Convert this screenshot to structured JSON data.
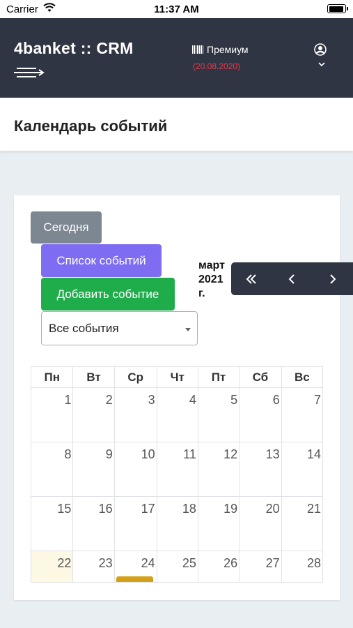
{
  "status_bar": {
    "carrier": "Carrier",
    "time": "11:37 AM"
  },
  "topbar": {
    "brand": "4banket :: CRM",
    "plan_label": "Премиум",
    "plan_date": "(20.08.2020)",
    "plan_date_color": "#e8384f",
    "icons": [
      "menu-icon",
      "barcode-icon",
      "user-circle-icon",
      "chevron-down-icon"
    ]
  },
  "page": {
    "title": "Календарь событий"
  },
  "buttons": {
    "today": "Сегодня",
    "list": "Список событий",
    "add": "Добавить событие"
  },
  "filter": {
    "selected": "Все события"
  },
  "month_title": {
    "month": "март",
    "year": "2021",
    "suffix": "г."
  },
  "nav": {
    "icons": [
      "double-chevron-left-icon",
      "chevron-left-icon",
      "chevron-right-icon"
    ]
  },
  "calendar": {
    "weekdays": [
      "Пн",
      "Вт",
      "Ср",
      "Чт",
      "Пт",
      "Сб",
      "Вс"
    ],
    "weeks": [
      [
        "1",
        "2",
        "3",
        "4",
        "5",
        "6",
        "7"
      ],
      [
        "8",
        "9",
        "10",
        "11",
        "12",
        "13",
        "14"
      ],
      [
        "15",
        "16",
        "17",
        "18",
        "19",
        "20",
        "21"
      ],
      [
        "22",
        "23",
        "24",
        "25",
        "26",
        "27",
        "28"
      ]
    ],
    "today": "22"
  },
  "colors": {
    "topbar_bg": "#2f3542",
    "today_btn": "#7c8791",
    "list_btn": "#7e6cf2",
    "add_btn": "#1fac4b",
    "today_cell": "#fcf8e3",
    "event_chip": "#d4a017"
  }
}
